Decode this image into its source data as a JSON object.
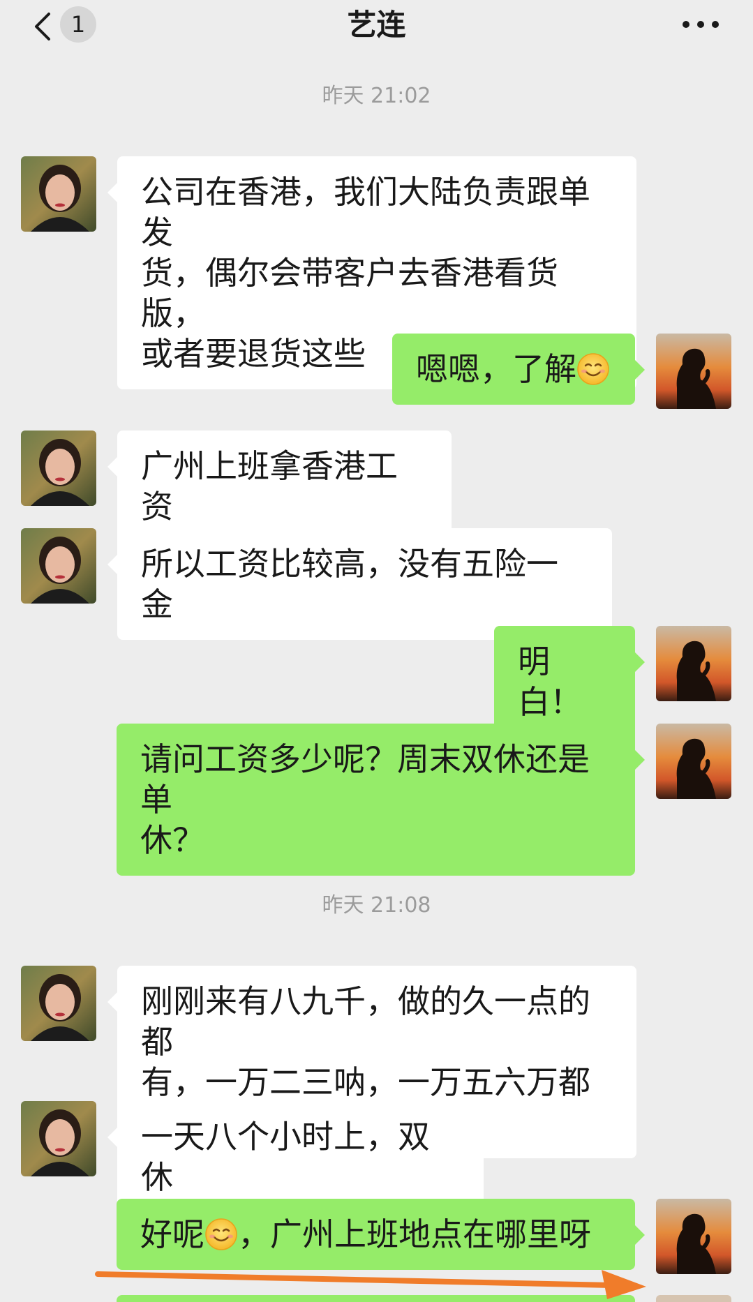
{
  "header": {
    "title": "艺连",
    "unread_count": "1",
    "back_icon": "chevron-left-icon",
    "more_icon": "ellipsis-icon"
  },
  "timestamps": [
    "昨天 21:02",
    "昨天 21:08"
  ],
  "messages": [
    {
      "side": "left",
      "text": "公司在香港，我们大陆负责跟单发\n货，偶尔会带客户去香港看货版，\n或者要退货这些"
    },
    {
      "side": "right",
      "text": "嗯嗯，了解",
      "emoji": "smile-emoji"
    },
    {
      "side": "left",
      "text": "广州上班拿香港工资"
    },
    {
      "side": "left",
      "text": "所以工资比较高，没有五险一金"
    },
    {
      "side": "right",
      "text": "明白！"
    },
    {
      "side": "right",
      "text": "请问工资多少呢？周末双休还是单\n休？"
    },
    {
      "side": "left",
      "text": "刚刚来有八九千，做的久一点的都\n有，一万二三呐，一万五六万都有"
    },
    {
      "side": "left",
      "text": "一天八个小时上，双休"
    },
    {
      "side": "right",
      "text_before": "好呢",
      "emoji": "smile-emoji",
      "text_after": "，广州上班地点在哪里呀"
    }
  ],
  "colors": {
    "background": "#ededed",
    "incoming_bubble": "#ffffff",
    "outgoing_bubble": "#95ec69",
    "timestamp_text": "#9b9b9b",
    "annotation_arrow": "#f07c2a"
  }
}
